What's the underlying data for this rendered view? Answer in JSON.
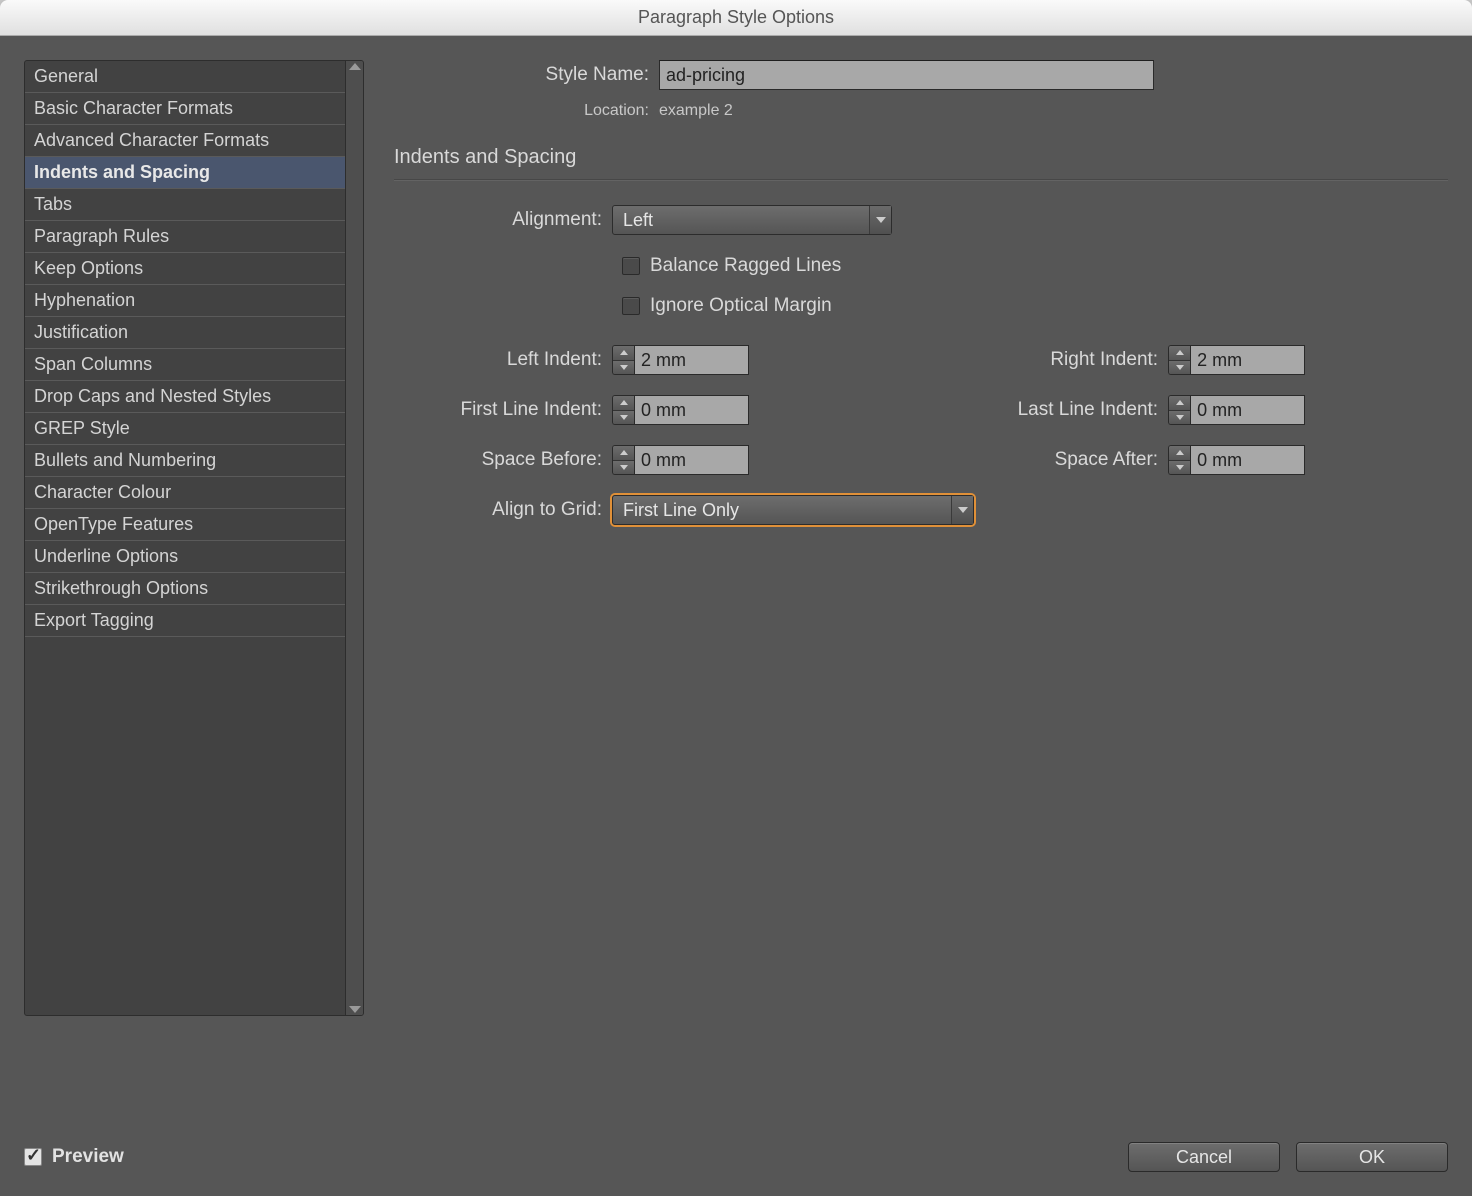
{
  "window": {
    "title": "Paragraph Style Options"
  },
  "sidebar": {
    "items": [
      "General",
      "Basic Character Formats",
      "Advanced Character Formats",
      "Indents and Spacing",
      "Tabs",
      "Paragraph Rules",
      "Keep Options",
      "Hyphenation",
      "Justification",
      "Span Columns",
      "Drop Caps and Nested Styles",
      "GREP Style",
      "Bullets and Numbering",
      "Character Colour",
      "OpenType Features",
      "Underline Options",
      "Strikethrough Options",
      "Export Tagging"
    ],
    "selected_index": 3
  },
  "header": {
    "style_name_label": "Style Name:",
    "style_name_value": "ad-pricing",
    "location_label": "Location:",
    "location_value": "example 2"
  },
  "section": {
    "title": "Indents and Spacing"
  },
  "fields": {
    "alignment_label": "Alignment:",
    "alignment_value": "Left",
    "balance_label": "Balance Ragged Lines",
    "ignore_label": "Ignore Optical Margin",
    "left_indent_label": "Left Indent:",
    "left_indent_value": "2 mm",
    "right_indent_label": "Right Indent:",
    "right_indent_value": "2 mm",
    "first_line_label": "First Line Indent:",
    "first_line_value": "0 mm",
    "last_line_label": "Last Line Indent:",
    "last_line_value": "0 mm",
    "space_before_label": "Space Before:",
    "space_before_value": "0 mm",
    "space_after_label": "Space After:",
    "space_after_value": "0 mm",
    "align_grid_label": "Align to Grid:",
    "align_grid_value": "First Line Only"
  },
  "footer": {
    "preview_label": "Preview",
    "cancel_label": "Cancel",
    "ok_label": "OK"
  }
}
